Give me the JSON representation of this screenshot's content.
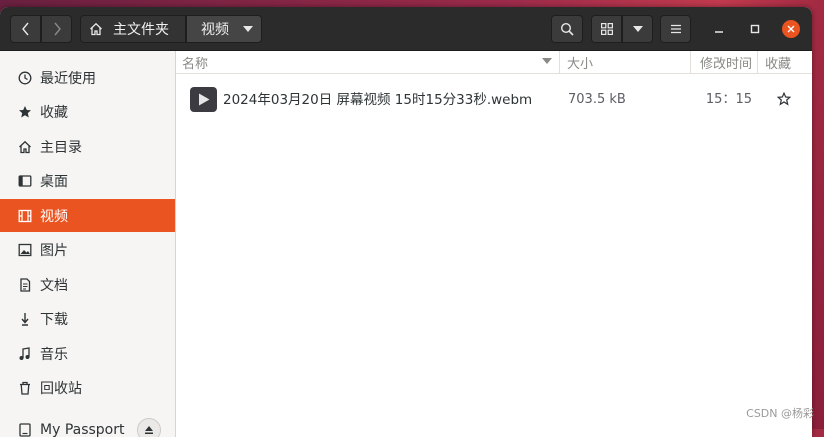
{
  "header": {
    "breadcrumb_home": "主文件夹",
    "breadcrumb_current": "视频"
  },
  "sidebar": {
    "items": [
      {
        "label": "最近使用",
        "icon": "clock-icon"
      },
      {
        "label": "收藏",
        "icon": "star-icon"
      },
      {
        "label": "主目录",
        "icon": "home-icon"
      },
      {
        "label": "桌面",
        "icon": "desktop-icon"
      },
      {
        "label": "视频",
        "icon": "film-icon"
      },
      {
        "label": "图片",
        "icon": "image-icon"
      },
      {
        "label": "文档",
        "icon": "document-icon"
      },
      {
        "label": "下载",
        "icon": "download-icon"
      },
      {
        "label": "音乐",
        "icon": "music-icon"
      },
      {
        "label": "回收站",
        "icon": "trash-icon"
      },
      {
        "label": "My Passport",
        "icon": "drive-icon"
      }
    ]
  },
  "columns": {
    "name": "名称",
    "size": "大小",
    "modified": "修改时间",
    "starred": "收藏"
  },
  "files": [
    {
      "name": "2024年03月20日 屏幕视频 15时15分33秒.webm",
      "size": "703.5 kB",
      "modified": "15：15",
      "icon": "video-file-icon"
    }
  ],
  "watermark": "CSDN @杨彩",
  "colors": {
    "accent": "#e95420",
    "headerbar": "#2b2b2b",
    "sidebar": "#f6f5f4"
  }
}
